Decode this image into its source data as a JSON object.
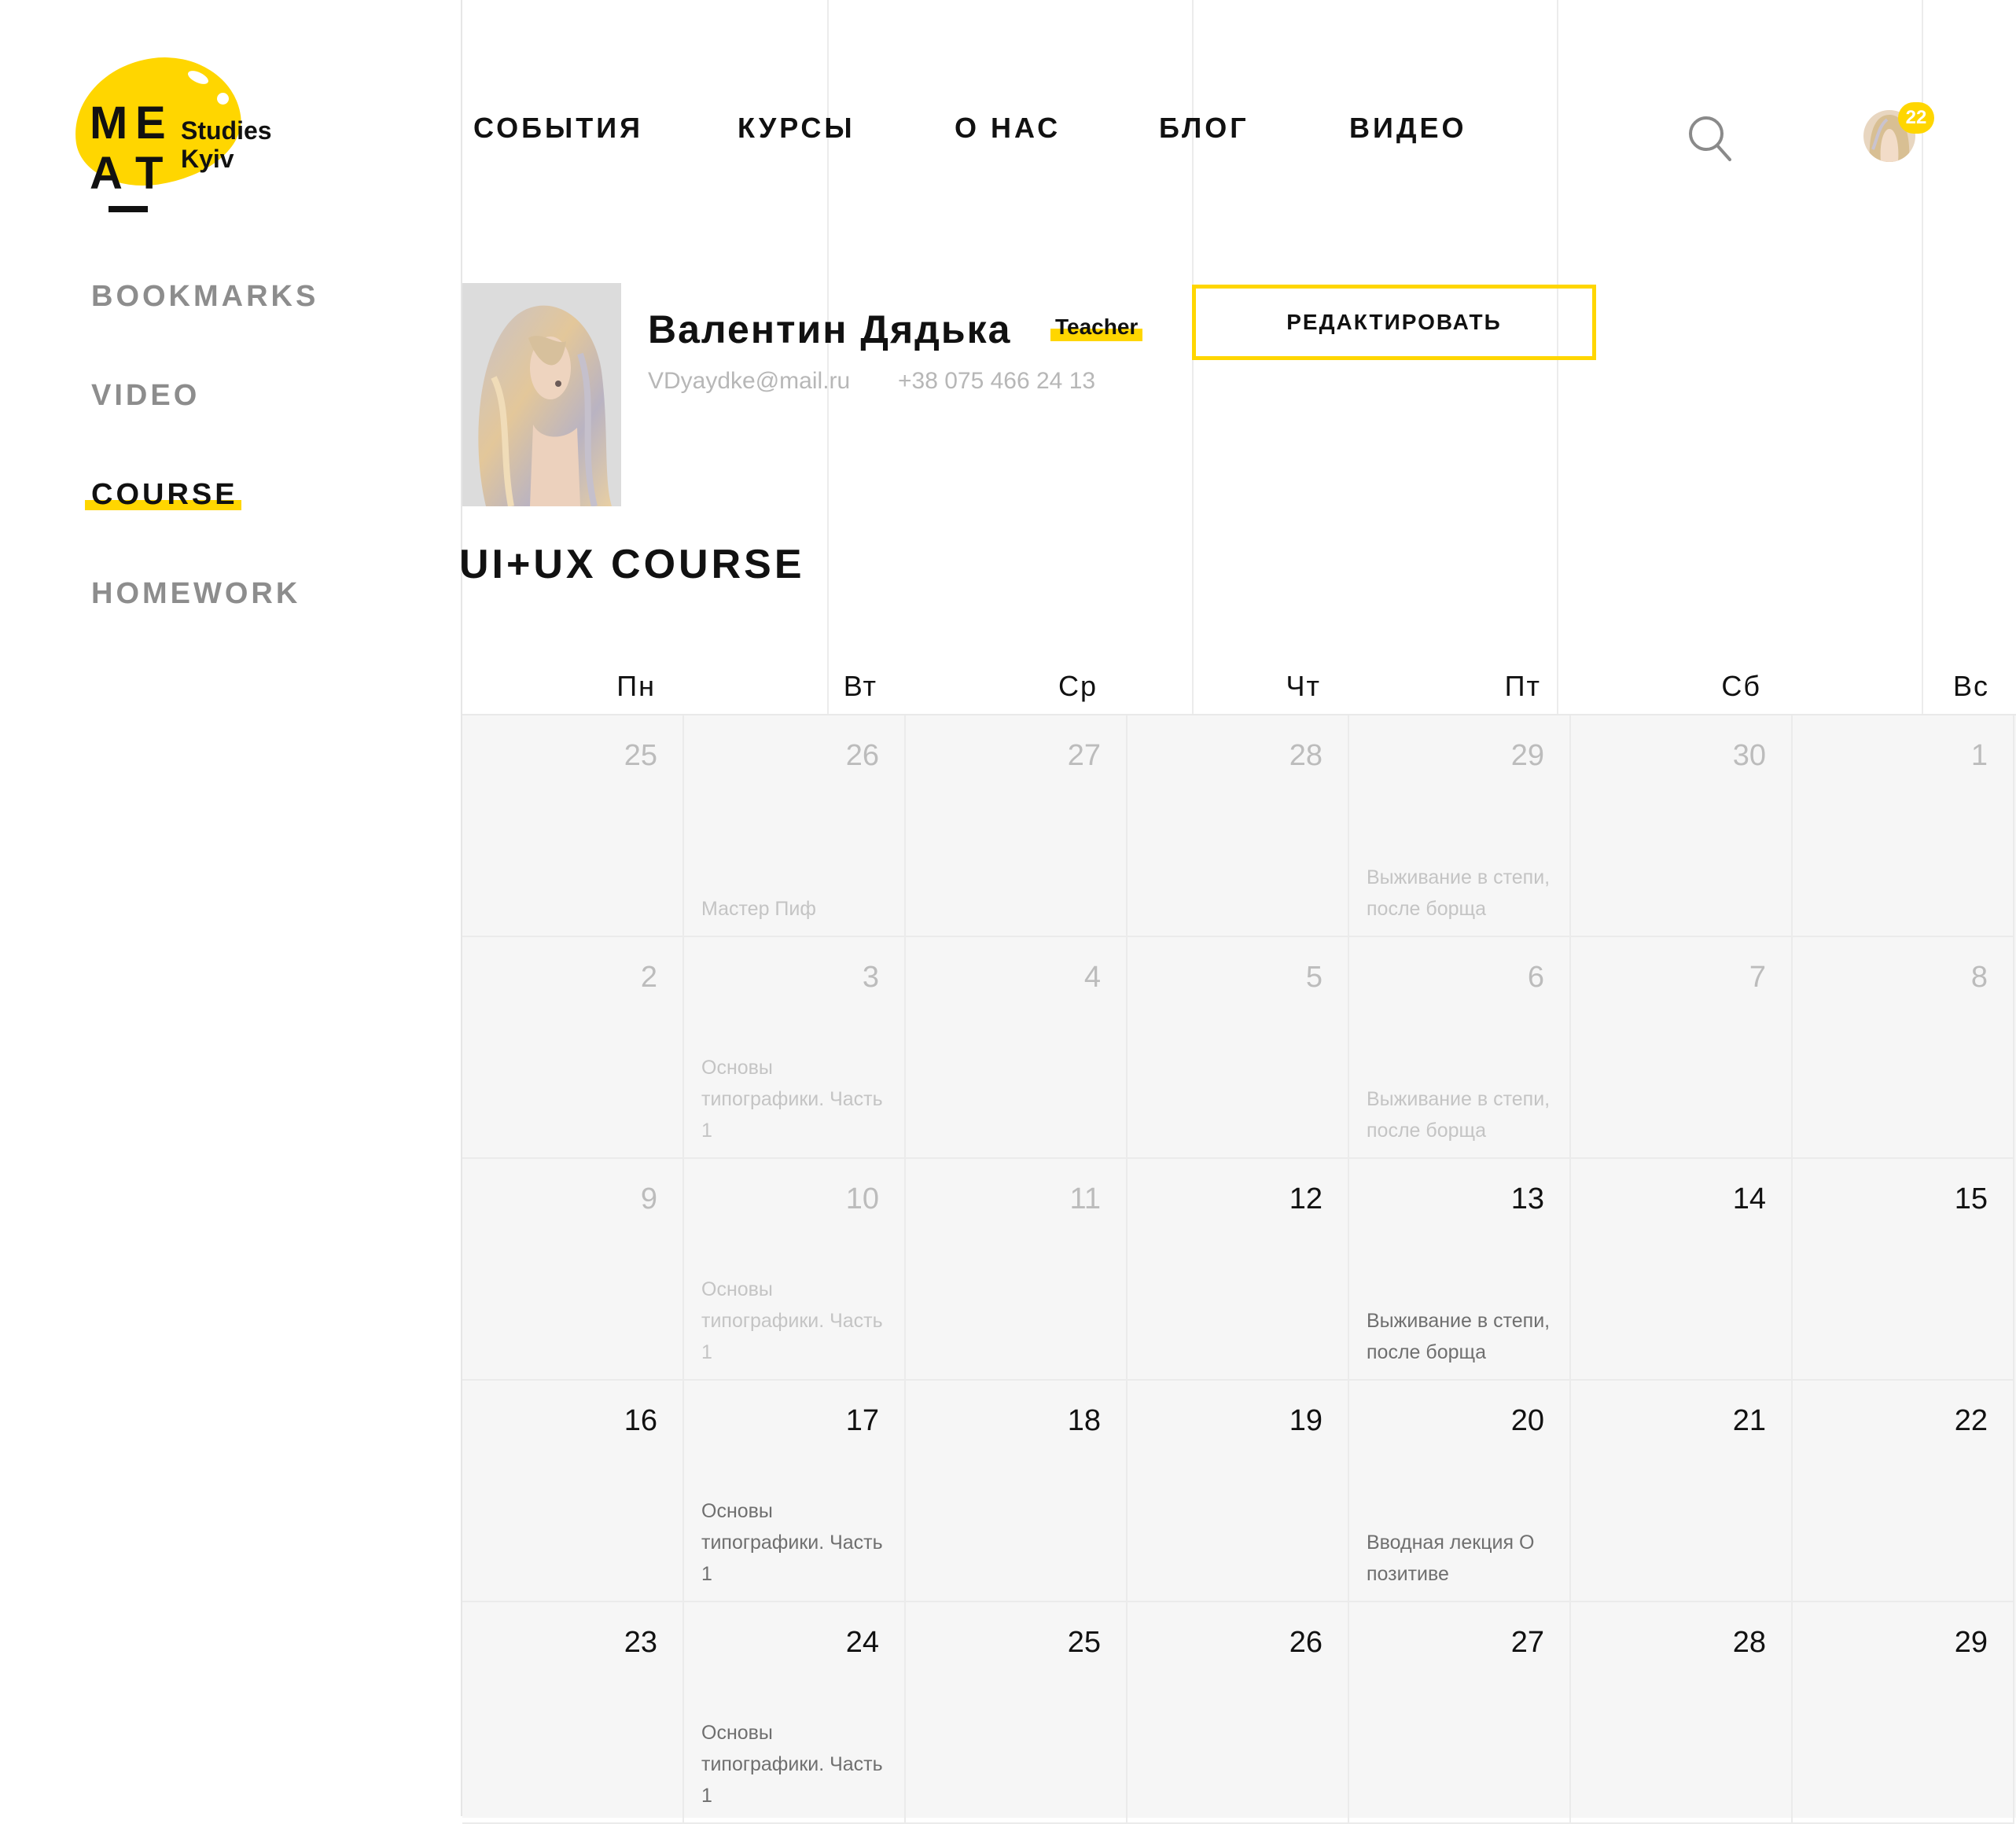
{
  "logo": {
    "letters": [
      "M",
      "E",
      "A",
      "T"
    ],
    "studio_line1": "Studies",
    "studio_line2": "Kyiv"
  },
  "sidebar": {
    "items": [
      {
        "label": "BOOKMARKS",
        "active": false
      },
      {
        "label": "VIDEO",
        "active": false
      },
      {
        "label": "COURSE",
        "active": true
      },
      {
        "label": "HOMEWORK",
        "active": false
      }
    ]
  },
  "nav": {
    "items": [
      "СОБЫТИЯ",
      "КУРСЫ",
      "О НАС",
      "БЛОГ",
      "ВИДЕО"
    ]
  },
  "header": {
    "notification_count": "22"
  },
  "profile": {
    "name": "Валентин Дядька",
    "role": "Teacher",
    "email": "VDyaydke@mail.ru",
    "phone": "+38 075 466 24 13",
    "edit_label": "РЕДАКТИРОВАТЬ"
  },
  "course": {
    "title": "UI+UX COURSE"
  },
  "calendar": {
    "weekdays": [
      "Пн",
      "Вт",
      "Ср",
      "Чт",
      "Пт",
      "Сб",
      "Вс"
    ],
    "weeks": [
      [
        {
          "day": "25",
          "muted": true
        },
        {
          "day": "26",
          "muted": true,
          "event": "Мастер Пиф"
        },
        {
          "day": "27",
          "muted": true
        },
        {
          "day": "28",
          "muted": true
        },
        {
          "day": "29",
          "muted": true,
          "event": "Выживание в степи, после борща"
        },
        {
          "day": "30",
          "muted": true
        },
        {
          "day": "1",
          "muted": true
        }
      ],
      [
        {
          "day": "2",
          "muted": true
        },
        {
          "day": "3",
          "muted": true,
          "event": "Основы типографики. Часть 1"
        },
        {
          "day": "4",
          "muted": true
        },
        {
          "day": "5",
          "muted": true
        },
        {
          "day": "6",
          "muted": true,
          "event": "Выживание в степи, после борща"
        },
        {
          "day": "7",
          "muted": true
        },
        {
          "day": "8",
          "muted": true
        }
      ],
      [
        {
          "day": "9",
          "muted": true
        },
        {
          "day": "10",
          "muted": true,
          "event": "Основы типографики. Часть 1"
        },
        {
          "day": "11",
          "muted": true
        },
        {
          "day": "12",
          "muted": false
        },
        {
          "day": "13",
          "muted": false,
          "event": "Выживание в степи, после борща"
        },
        {
          "day": "14",
          "muted": false
        },
        {
          "day": "15",
          "muted": false
        }
      ],
      [
        {
          "day": "16",
          "muted": false
        },
        {
          "day": "17",
          "muted": false,
          "event": "Основы типографики. Часть 1"
        },
        {
          "day": "18",
          "muted": false
        },
        {
          "day": "19",
          "muted": false
        },
        {
          "day": "20",
          "muted": false,
          "event": "Вводная лекция О позитиве"
        },
        {
          "day": "21",
          "muted": false
        },
        {
          "day": "22",
          "muted": false
        }
      ],
      [
        {
          "day": "23",
          "muted": false
        },
        {
          "day": "24",
          "muted": false,
          "event": "Основы типографики. Часть 1"
        },
        {
          "day": "25",
          "muted": false
        },
        {
          "day": "26",
          "muted": false
        },
        {
          "day": "27",
          "muted": false
        },
        {
          "day": "28",
          "muted": false
        },
        {
          "day": "29",
          "muted": false
        }
      ]
    ]
  },
  "colors": {
    "accent": "#ffd600",
    "muted_text": "#bcbcbc",
    "grid_bg": "#f6f6f6"
  }
}
